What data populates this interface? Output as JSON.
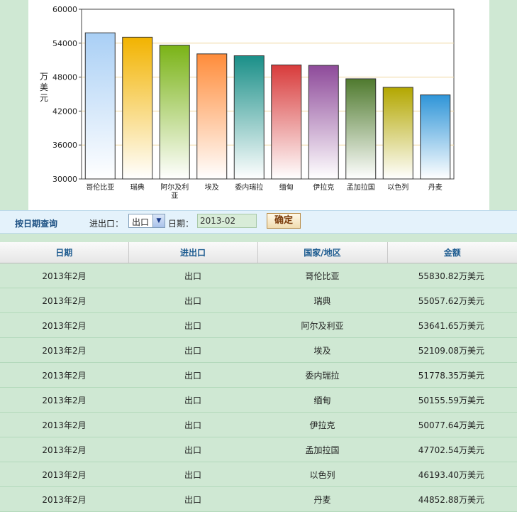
{
  "chart_data": {
    "type": "bar",
    "ylabel": "万美元",
    "ylim": [
      30000,
      60000
    ],
    "yticks": [
      30000,
      36000,
      42000,
      48000,
      54000,
      60000
    ],
    "categories": [
      "哥伦比亚",
      "瑞典",
      "阿尔及利亚",
      "埃及",
      "委内瑞拉",
      "缅甸",
      "伊拉克",
      "孟加拉国",
      "以色列",
      "丹麦"
    ],
    "values": [
      55830.82,
      55057.62,
      53641.65,
      52109.08,
      51778.35,
      50155.59,
      50077.64,
      47702.54,
      46193.4,
      44852.88
    ],
    "colors": [
      "#a9cff5",
      "#f2b300",
      "#7ab316",
      "#ff8c3a",
      "#1a8f88",
      "#d83b3b",
      "#8e4a9a",
      "#4f7a2e",
      "#b3a700",
      "#2f95d8"
    ],
    "grid_color": "#f0d8a0"
  },
  "query": {
    "title": "按日期查询",
    "type_label": "进出口：",
    "type_value": "出口",
    "date_label": "日期：",
    "date_value": "2013-02",
    "submit_label": "确定"
  },
  "table": {
    "headers": [
      "日期",
      "进出口",
      "国家/地区",
      "金额"
    ],
    "rows": [
      [
        "2013年2月",
        "出口",
        "哥伦比亚",
        "55830.82万美元"
      ],
      [
        "2013年2月",
        "出口",
        "瑞典",
        "55057.62万美元"
      ],
      [
        "2013年2月",
        "出口",
        "阿尔及利亚",
        "53641.65万美元"
      ],
      [
        "2013年2月",
        "出口",
        "埃及",
        "52109.08万美元"
      ],
      [
        "2013年2月",
        "出口",
        "委内瑞拉",
        "51778.35万美元"
      ],
      [
        "2013年2月",
        "出口",
        "缅甸",
        "50155.59万美元"
      ],
      [
        "2013年2月",
        "出口",
        "伊拉克",
        "50077.64万美元"
      ],
      [
        "2013年2月",
        "出口",
        "孟加拉国",
        "47702.54万美元"
      ],
      [
        "2013年2月",
        "出口",
        "以色列",
        "46193.40万美元"
      ],
      [
        "2013年2月",
        "出口",
        "丹麦",
        "44852.88万美元"
      ]
    ]
  }
}
